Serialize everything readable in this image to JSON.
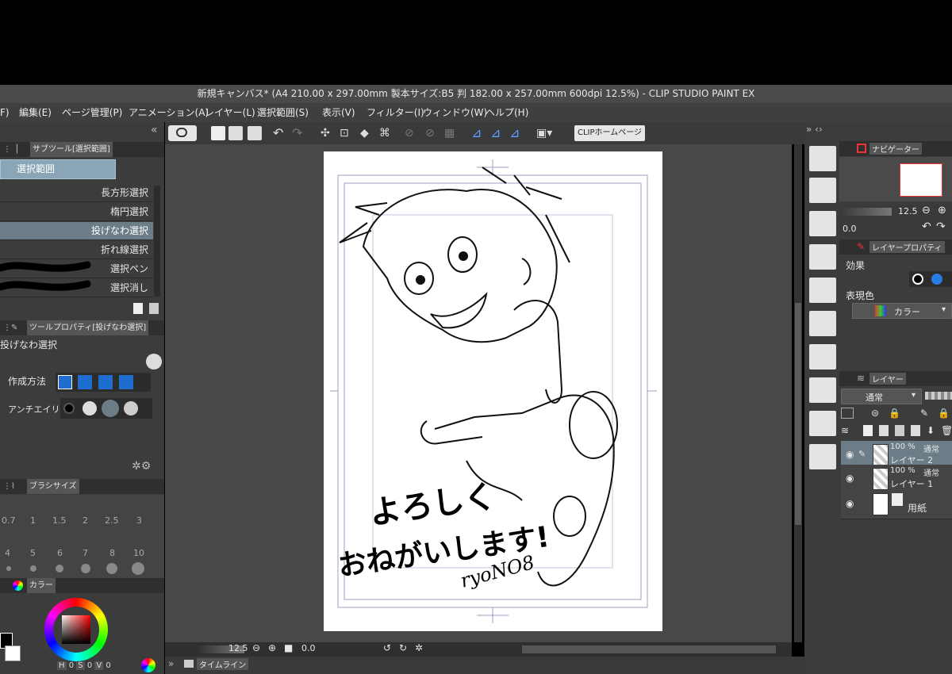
{
  "window": {
    "title": "新規キャンバス* (A4 210.00 x 297.00mm 製本サイズ:B5 判 182.00 x 257.00mm 600dpi 12.5%)  - CLIP STUDIO PAINT EX"
  },
  "menu": [
    "F)",
    "編集(E)",
    "ページ管理(P)",
    "アニメーション(A)",
    "レイヤー(L)",
    "選択範囲(S)",
    "表示(V)",
    "フィルター(I)",
    "ウィンドウ(W)",
    "ヘルプ(H)"
  ],
  "toolbar": {
    "clip_button": "CLIPホームページ"
  },
  "subtool": {
    "panel_title": "サブツール[選択範囲]",
    "group": "選択範囲",
    "items": [
      "長方形選択",
      "楕円選択",
      "投げなわ選択",
      "折れ線選択",
      "選択ペン",
      "選択消し"
    ],
    "selected_index": 2
  },
  "tool_property": {
    "panel_title": "ツールプロパティ[投げなわ選択]",
    "tool_name": "投げなわ選択",
    "create_method_label": "作成方法",
    "antialias_label": "アンチエイリアス"
  },
  "brush_size": {
    "panel_title": "ブラシサイズ",
    "sizes_row1": [
      "0.7",
      "1",
      "1.5",
      "2",
      "2.5",
      "3"
    ],
    "sizes_row2": [
      "4",
      "5",
      "6",
      "7",
      "8",
      "10"
    ]
  },
  "color": {
    "panel_title": "カラー",
    "h_label": "H",
    "h_value": "0",
    "s_label": "S",
    "s_value": "0",
    "v_label": "V",
    "v_value": "0",
    "main_color": "#000000"
  },
  "canvas": {
    "zoom": "12.5",
    "rotation": "0.0",
    "drawing_text_line1": "よろしく",
    "drawing_text_line2": "おねがいします!",
    "signature": "ryoNO8"
  },
  "timeline": {
    "label": "タイムライン"
  },
  "navigator": {
    "panel_title": "ナビゲーター",
    "zoom": "12.5",
    "rotation": "0.0"
  },
  "layer_property": {
    "panel_title": "レイヤープロパティ",
    "effect_label": "効果",
    "expression_label": "表現色",
    "expression_value": "カラー"
  },
  "layers": {
    "panel_title": "レイヤー",
    "blend_mode": "通常",
    "items": [
      {
        "opacity": "100 %",
        "mode": "通常",
        "name": "レイヤー 2",
        "selected": true
      },
      {
        "opacity": "100 %",
        "mode": "通常",
        "name": "レイヤー 1",
        "selected": false
      },
      {
        "opacity": "",
        "mode": "",
        "name": "用紙",
        "selected": false
      }
    ]
  }
}
